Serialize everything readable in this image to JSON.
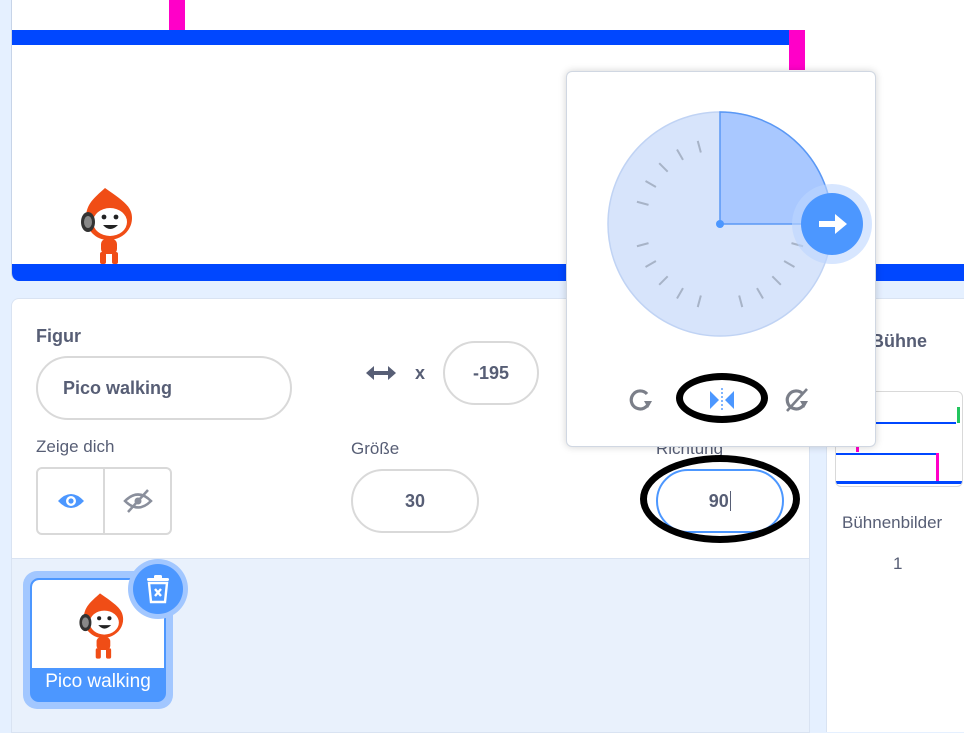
{
  "sprite_info": {
    "sprite_label": "Figur",
    "sprite_name": "Pico walking",
    "x_label": "x",
    "x_value": "-195",
    "show_label": "Zeige dich",
    "size_label": "Größe",
    "size_value": "30",
    "direction_label": "Richtung",
    "direction_value": "90"
  },
  "sprite_list": {
    "sprites": [
      {
        "name": "Pico walking"
      }
    ]
  },
  "stage_pane": {
    "title": "Bühne",
    "backdrops_label": "Bühnenbilder",
    "backdrops_count": "1"
  },
  "direction_popover": {
    "direction_degrees": 90,
    "rotation_styles": [
      "all-around-icon",
      "left-right-icon",
      "dont-rotate-icon"
    ],
    "selected_style": "left-right-icon"
  },
  "colors": {
    "accent": "#4c97ff",
    "wall_blue": "#0047ff",
    "wall_pink": "#ff00c8",
    "text": "#575e75"
  }
}
